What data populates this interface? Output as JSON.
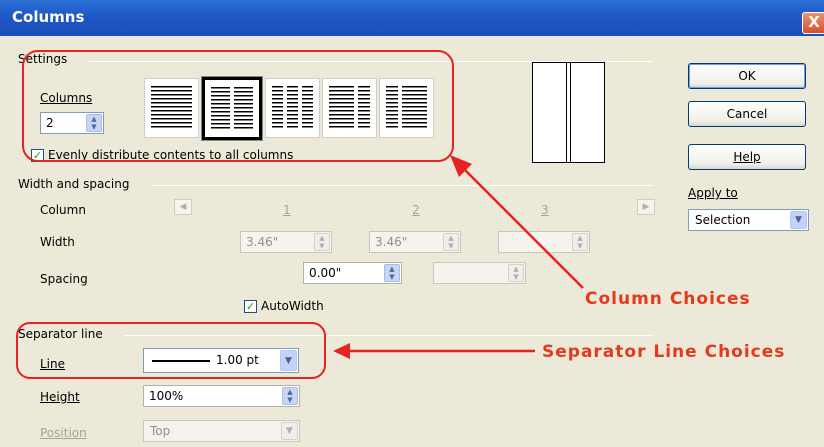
{
  "dialog": {
    "title": "Columns",
    "close_glyph": "X"
  },
  "settings": {
    "group_label": "Settings",
    "columns_label": "Columns",
    "columns_value": "2",
    "layouts": [
      {
        "name": "one-column",
        "columns": 1,
        "selected": false
      },
      {
        "name": "two-columns",
        "columns": 2,
        "selected": true
      },
      {
        "name": "three-columns",
        "columns": 3,
        "selected": false
      },
      {
        "name": "two-columns-left-wide",
        "columns": 2,
        "selected": false
      },
      {
        "name": "two-columns-right-wide",
        "columns": 2,
        "selected": false
      }
    ],
    "evenly_label": "Evenly distribute contents to all columns",
    "evenly_checked": true
  },
  "width_spacing": {
    "group_label": "Width and spacing",
    "column_label": "Column",
    "width_label": "Width",
    "spacing_label": "Spacing",
    "col_numbers": [
      "1",
      "2",
      "3"
    ],
    "widths": [
      "3.46\"",
      "3.46\"",
      ""
    ],
    "spacings": [
      "0.00\"",
      ""
    ],
    "autowidth_label": "AutoWidth",
    "autowidth_checked": true
  },
  "separator": {
    "group_label": "Separator line",
    "line_label": "Line",
    "line_value": "1.00 pt",
    "height_label": "Height",
    "height_value": "100%",
    "position_label": "Position",
    "position_value": "Top"
  },
  "buttons": {
    "ok": "OK",
    "cancel": "Cancel",
    "help": "Help"
  },
  "apply_to": {
    "label": "Apply to",
    "value": "Selection"
  },
  "annotations": {
    "column_choices": "Column Choices",
    "separator_choices": "Separator Line Choices",
    "color": "#e52323"
  }
}
